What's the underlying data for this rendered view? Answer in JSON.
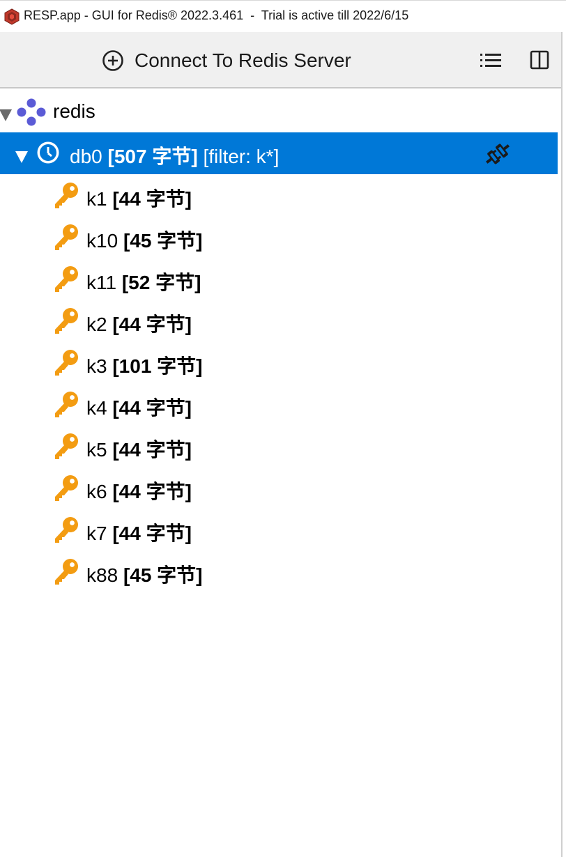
{
  "window": {
    "title": "RESP.app - GUI for Redis® 2022.3.461  -  Trial is active till 2022/6/15"
  },
  "toolbar": {
    "connect_label": "Connect To Redis Server"
  },
  "tree": {
    "server": {
      "name": "redis"
    },
    "database": {
      "name": "db0",
      "size": "[507 字节]",
      "filter": "[filter: k*]"
    },
    "keys": [
      {
        "name": "k1",
        "size": "[44 字节]"
      },
      {
        "name": "k10",
        "size": "[45 字节]"
      },
      {
        "name": "k11",
        "size": "[52 字节]"
      },
      {
        "name": "k2",
        "size": "[44 字节]"
      },
      {
        "name": "k3",
        "size": "[101 字节]"
      },
      {
        "name": "k4",
        "size": "[44 字节]"
      },
      {
        "name": "k5",
        "size": "[44 字节]"
      },
      {
        "name": "k6",
        "size": "[44 字节]"
      },
      {
        "name": "k7",
        "size": "[44 字节]"
      },
      {
        "name": "k88",
        "size": "[45 字节]"
      }
    ]
  },
  "colors": {
    "selection": "#0078d7",
    "key_icon": "#f39c12",
    "server_icon": "#5b5bd6"
  }
}
